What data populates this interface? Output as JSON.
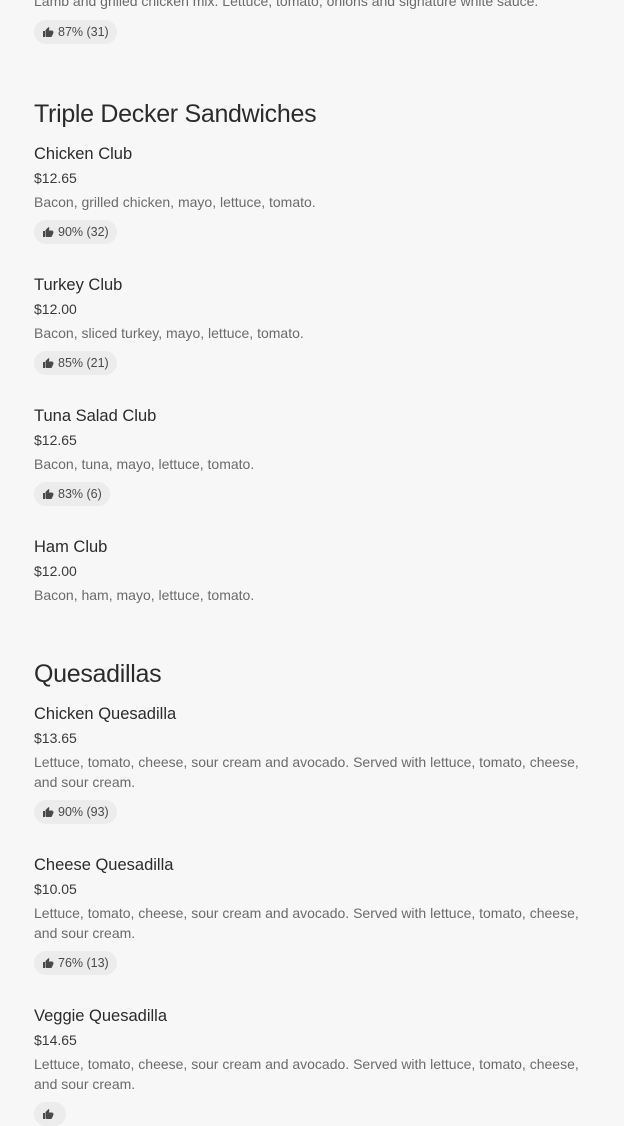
{
  "previous_item": {
    "description": "Lamb and grilled chicken mix. Lettuce, tomato, onions and signature white sauce.",
    "rating": "87% (31)"
  },
  "sections": [
    {
      "title": "Triple Decker Sandwiches",
      "items": [
        {
          "name": "Chicken Club",
          "price": "$12.65",
          "description": "Bacon, grilled chicken, mayo, lettuce, tomato.",
          "rating": "90% (32)"
        },
        {
          "name": "Turkey Club",
          "price": "$12.00",
          "description": "Bacon, sliced turkey, mayo, lettuce, tomato.",
          "rating": "85% (21)"
        },
        {
          "name": "Tuna Salad Club",
          "price": "$12.65",
          "description": "Bacon, tuna, mayo, lettuce, tomato.",
          "rating": "83% (6)"
        },
        {
          "name": "Ham Club",
          "price": "$12.00",
          "description": "Bacon, ham, mayo, lettuce, tomato.",
          "rating": ""
        }
      ]
    },
    {
      "title": "Quesadillas",
      "items": [
        {
          "name": "Chicken Quesadilla",
          "price": "$13.65",
          "description": "Lettuce, tomato, cheese, sour cream and avocado. Served with lettuce, tomato, cheese, and sour cream.",
          "rating": "90% (93)"
        },
        {
          "name": "Cheese Quesadilla",
          "price": "$10.05",
          "description": "Lettuce, tomato, cheese, sour cream and avocado. Served with lettuce, tomato, cheese, and sour cream.",
          "rating": "76% (13)"
        },
        {
          "name": "Veggie Quesadilla",
          "price": "$14.65",
          "description": "Lettuce, tomato, cheese, sour cream and avocado. Served with lettuce, tomato, cheese, and sour cream.",
          "rating": ""
        }
      ]
    }
  ],
  "icons": {
    "rating": "thumbs-up-icon"
  },
  "colors": {
    "background": "#f7f7f7",
    "rating_chip": "#ececec",
    "text_primary": "#2b2b2b",
    "text_secondary": "#6b6b6b"
  }
}
